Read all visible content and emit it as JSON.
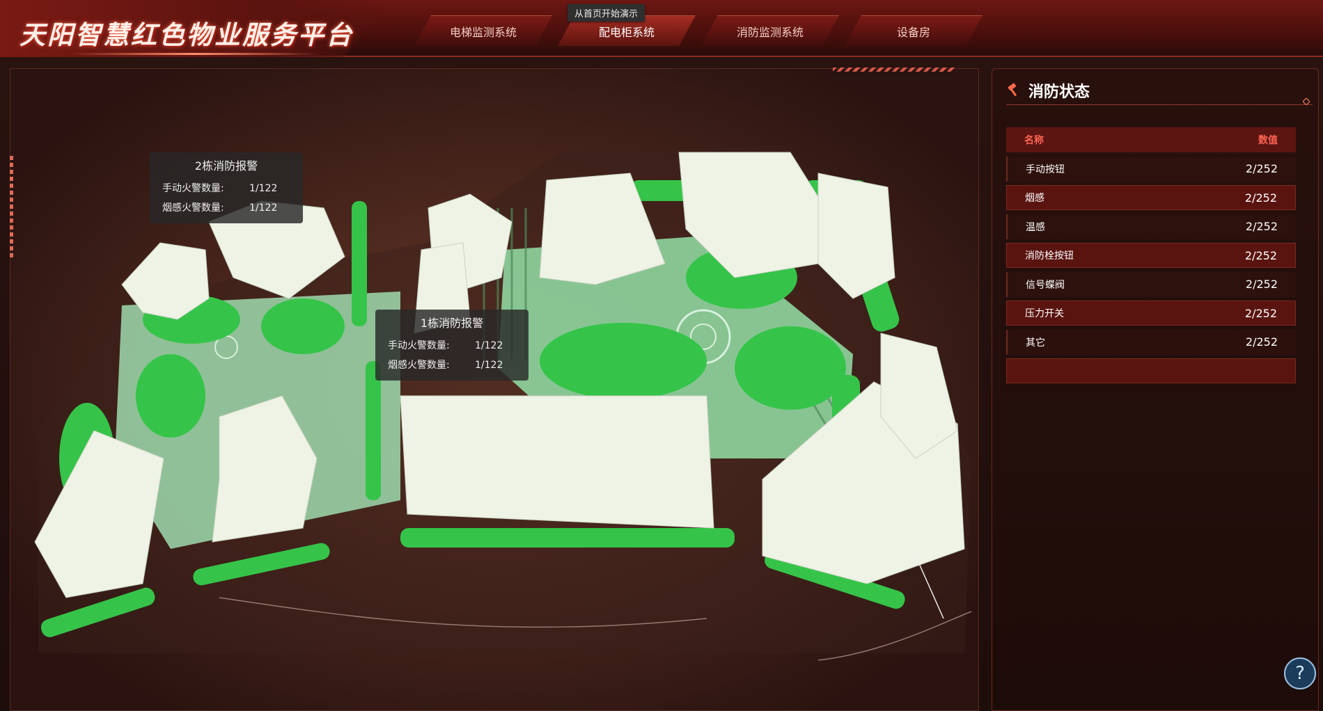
{
  "header": {
    "title": "天阳智慧红色物业服务平台",
    "tabs": [
      {
        "label": "电梯监测系统"
      },
      {
        "label": "配电柜系统"
      },
      {
        "label": "消防监测系统"
      },
      {
        "label": "设备房"
      }
    ],
    "active_tab": "配电柜系统",
    "demo_tooltip": "从首页开始演示"
  },
  "scene": {
    "popups": [
      {
        "title": "2栋消防报警",
        "rows": [
          {
            "label": "手动火警数量:",
            "value": "1/122"
          },
          {
            "label": "烟感火警数量:",
            "value": "1/122"
          }
        ]
      },
      {
        "title": "1栋消防报警",
        "rows": [
          {
            "label": "手动火警数量:",
            "value": "1/122"
          },
          {
            "label": "烟感火警数量:",
            "value": "1/122"
          }
        ]
      }
    ]
  },
  "panel": {
    "title": "消防状态",
    "columns": [
      "名称",
      "数值"
    ],
    "rows": [
      {
        "name": "手动按钮",
        "value": "2/252"
      },
      {
        "name": "烟感",
        "value": "2/252"
      },
      {
        "name": "温感",
        "value": "2/252"
      },
      {
        "name": "消防栓按钮",
        "value": "2/252"
      },
      {
        "name": "信号蝶阀",
        "value": "2/252"
      },
      {
        "name": "压力开关",
        "value": "2/252"
      },
      {
        "name": "其它",
        "value": "2/252"
      }
    ]
  },
  "help": {
    "label": "?"
  },
  "colors": {
    "accent": "#ff6655",
    "panel_row": "#5a1410",
    "vegetation": "#3fbf4a",
    "building": "#eef3e6"
  }
}
